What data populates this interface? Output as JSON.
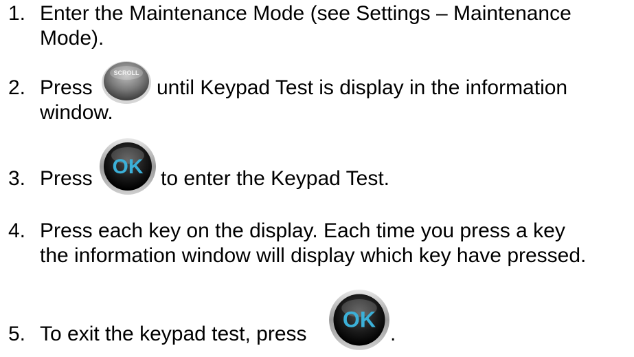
{
  "steps": [
    {
      "number": "1.",
      "line1": "Enter the Maintenance Mode (see Settings – Maintenance",
      "line2": "Mode)."
    },
    {
      "number": "2.",
      "before": "Press",
      "after": "until Keypad Test is display in the information",
      "line2": "window.",
      "icon_label": "SCROLL",
      "icon": "scroll-button-icon"
    },
    {
      "number": "3.",
      "before": "Press",
      "after": "to enter the Keypad Test.",
      "icon_label": "OK",
      "icon": "ok-button-icon"
    },
    {
      "number": "4.",
      "line1": "Press each key on the display. Each time you press a key",
      "line2": "the information window will display which key have pressed."
    },
    {
      "number": "5.",
      "before": "To exit the keypad test, press",
      "after": ".",
      "icon_label": "OK",
      "icon": "ok-button-icon"
    }
  ],
  "colors": {
    "ok_text": "#3bb0d8",
    "button_dark": "#1a1a1a",
    "scroll_silver": "#8a8a8a"
  }
}
